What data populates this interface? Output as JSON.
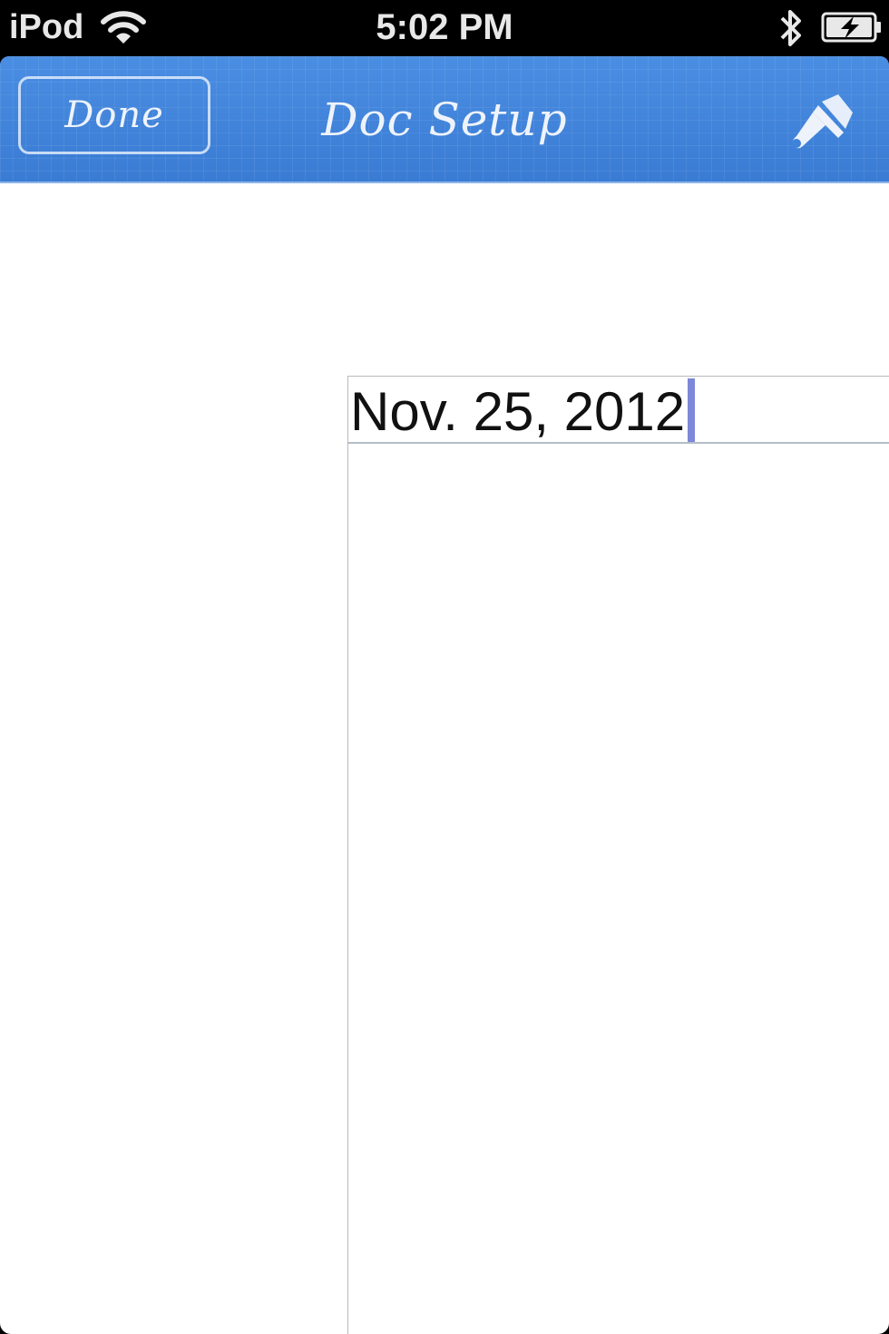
{
  "status_bar": {
    "carrier": "iPod",
    "time": "5:02 PM",
    "icons": [
      "wifi-icon",
      "bluetooth-icon",
      "battery-charging-icon"
    ]
  },
  "nav_bar": {
    "done_label": "Done",
    "title": "Doc Setup",
    "right_icon": "paint-brush-icon",
    "background_color": "#3f82d9"
  },
  "document": {
    "date_value": "Nov. 25, 2012"
  }
}
